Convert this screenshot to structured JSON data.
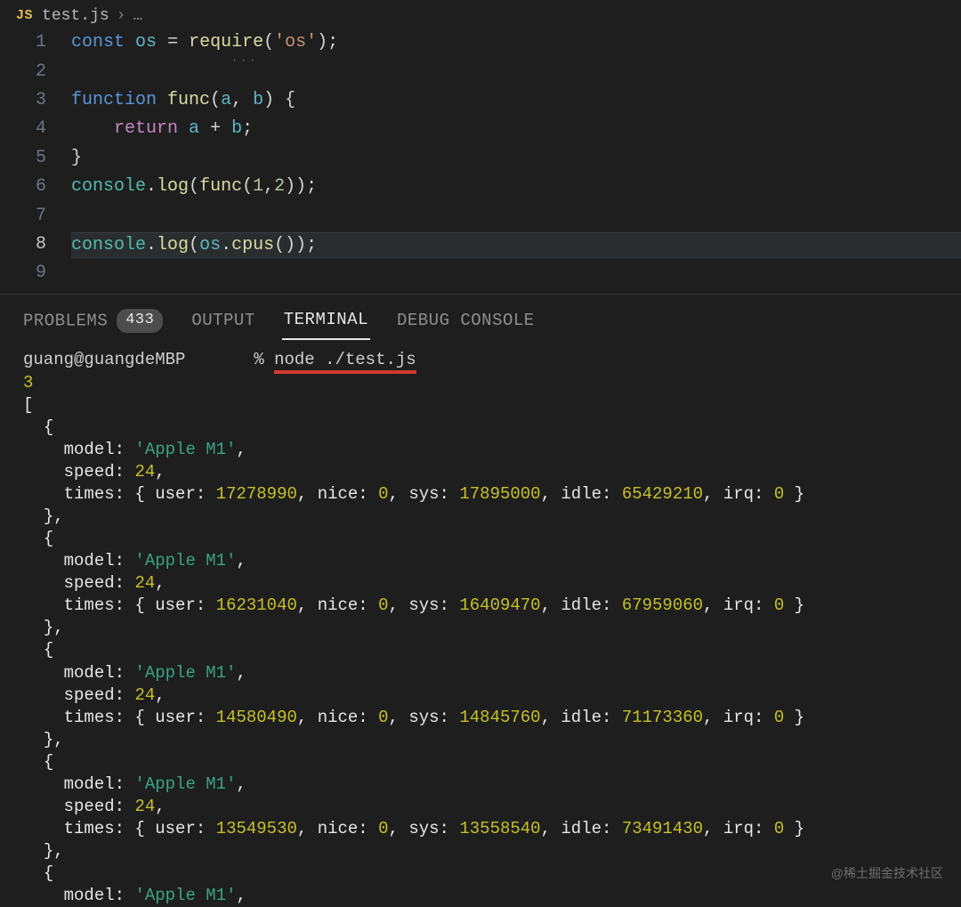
{
  "breadcrumb": {
    "icon": "JS",
    "file": "test.js",
    "chevron": "›",
    "dots": "…"
  },
  "editor": {
    "lines": [
      "1",
      "2",
      "3",
      "4",
      "5",
      "6",
      "7",
      "8",
      "9"
    ],
    "t": {
      "const": "const",
      "os": "os",
      "eq": "=",
      "require": "require",
      "str_os": "'os'",
      "lp": "(",
      "rp": ")",
      "sc": ";",
      "function": "function",
      "func": "func",
      "a": "a",
      "b": "b",
      "comma": ",",
      "sp": " ",
      "lbrace": "{",
      "rbrace": "}",
      "return": "return",
      "plus": "+",
      "console": "console",
      "dot": ".",
      "log": "log",
      "n1": "1",
      "n2": "2",
      "cpus": "cpus"
    }
  },
  "panel": {
    "tabs": {
      "problems": "PROBLEMS",
      "badge": "433",
      "output": "OUTPUT",
      "terminal": "TERMINAL",
      "debug": "DEBUG CONSOLE"
    }
  },
  "terminal": {
    "prompt_user": "guang@guangdeMBP",
    "prompt_symbol": "%",
    "command": "node ./test.js",
    "first_num": "3",
    "labels": {
      "model": "model:",
      "speed": "speed:",
      "times": "times:",
      "user": "user:",
      "nice": "nice:",
      "sys": "sys:",
      "idle": "idle:",
      "irq": "irq:",
      "lbr": "[",
      "rbr": "]",
      "lcb": "{",
      "rcb": "}",
      "comma": ","
    },
    "cpus": [
      {
        "model": "'Apple M1'",
        "speed": "24",
        "user": "17278990",
        "nice": "0",
        "sys": "17895000",
        "idle": "65429210",
        "irq": "0"
      },
      {
        "model": "'Apple M1'",
        "speed": "24",
        "user": "16231040",
        "nice": "0",
        "sys": "16409470",
        "idle": "67959060",
        "irq": "0"
      },
      {
        "model": "'Apple M1'",
        "speed": "24",
        "user": "14580490",
        "nice": "0",
        "sys": "14845760",
        "idle": "71173360",
        "irq": "0"
      },
      {
        "model": "'Apple M1'",
        "speed": "24",
        "user": "13549530",
        "nice": "0",
        "sys": "13558540",
        "idle": "73491430",
        "irq": "0"
      }
    ],
    "truncated_last": {
      "model": "'Apple M1'"
    }
  },
  "watermark": "@稀土掘金技术社区"
}
